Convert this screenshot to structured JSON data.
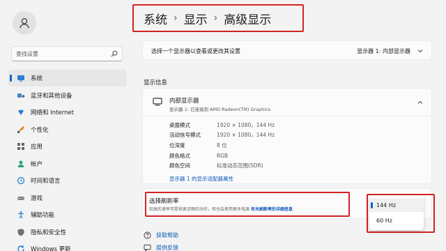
{
  "sidebar": {
    "search_placeholder": "查找设置",
    "items": [
      {
        "label": "系统",
        "icon": "monitor-icon",
        "active": true
      },
      {
        "label": "蓝牙和其他设备",
        "icon": "bluetooth-icon"
      },
      {
        "label": "网络和 Internet",
        "icon": "wifi-icon"
      },
      {
        "label": "个性化",
        "icon": "brush-icon"
      },
      {
        "label": "应用",
        "icon": "apps-icon"
      },
      {
        "label": "帐户",
        "icon": "person-icon"
      },
      {
        "label": "时间和语言",
        "icon": "globe-clock-icon"
      },
      {
        "label": "游戏",
        "icon": "gamepad-icon"
      },
      {
        "label": "辅助功能",
        "icon": "accessibility-icon"
      },
      {
        "label": "隐私和安全性",
        "icon": "shield-icon"
      },
      {
        "label": "Windows 更新",
        "icon": "update-icon"
      }
    ]
  },
  "breadcrumb": {
    "part1": "系统",
    "part2": "显示",
    "current": "高级显示"
  },
  "display_select": {
    "label": "选择一个显示器以查看或更改其设置",
    "value": "显示器 1: 内部显示器"
  },
  "section_title": "显示信息",
  "info": {
    "name": "内部显示器",
    "sub": "显示器 1: 已连接到 AMD Radeon(TM) Graphics",
    "rows": [
      {
        "k": "桌面模式",
        "v": "1920 × 1080，144 Hz"
      },
      {
        "k": "活动信号模式",
        "v": "1920 × 1080，144 Hz"
      },
      {
        "k": "位深度",
        "v": "8 位"
      },
      {
        "k": "颜色格式",
        "v": "RGB"
      },
      {
        "k": "颜色空间",
        "v": "标准动态范围(SDR)"
      }
    ],
    "adapter_link": "显示器 1 的显示适配器属性"
  },
  "refresh": {
    "title": "选择刷新率",
    "desc": "较高的速率可提供更流畅的动作，但也会使用更多电源",
    "link": "有关刷新率的详细信息",
    "options": [
      "144 Hz",
      "60 Hz"
    ],
    "selected": "144 Hz"
  },
  "footer": {
    "help": "获取帮助",
    "feedback": "提供反馈"
  },
  "colors": {
    "accent": "#0067c0",
    "highlight": "#d32222",
    "link": "#0a58b5"
  }
}
